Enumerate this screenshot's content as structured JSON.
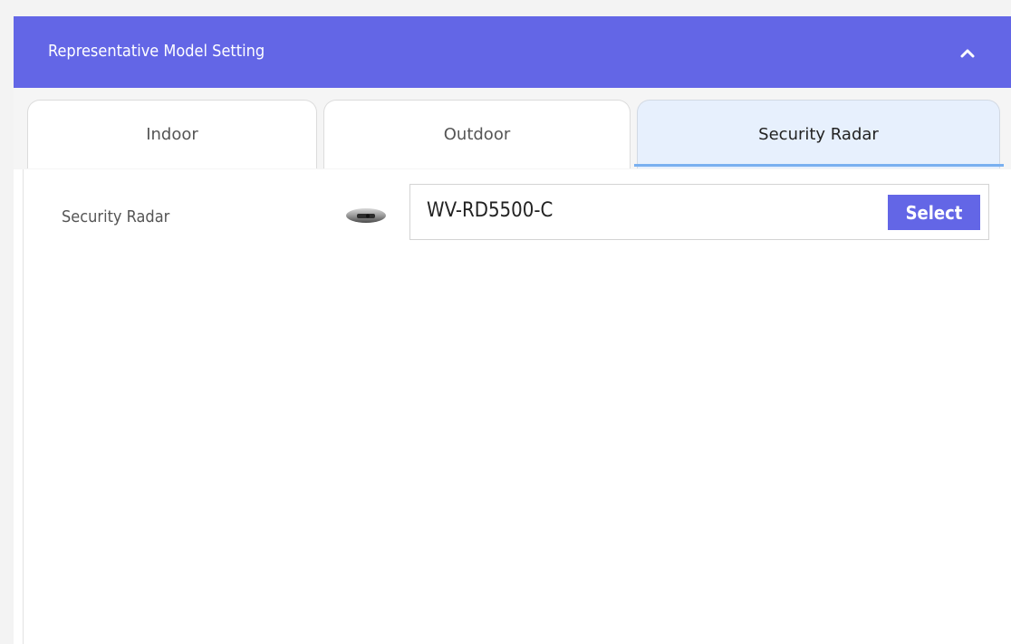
{
  "panel": {
    "title": "Representative Model Setting",
    "collapse_icon": "chevron-up-icon",
    "header_color": "#6366e6"
  },
  "tabs": [
    {
      "label": "Indoor",
      "active": false
    },
    {
      "label": "Outdoor",
      "active": false
    },
    {
      "label": "Security Radar",
      "active": true
    }
  ],
  "field": {
    "label": "Security Radar",
    "icon": "security-radar-device-icon",
    "model_value": "WV-RD5500-C",
    "select_label": "Select"
  }
}
